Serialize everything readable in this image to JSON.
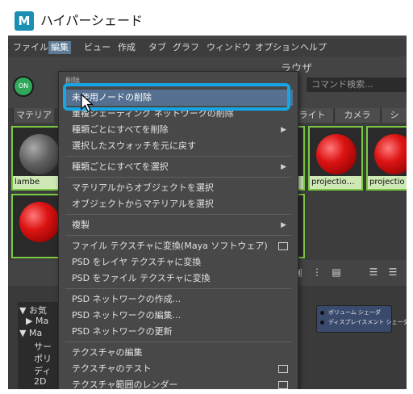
{
  "window": {
    "app_icon_letter": "M",
    "title": "ハイパーシェード"
  },
  "menubar": {
    "items": [
      "ファイル",
      "編集",
      "ビュー",
      "作成",
      "タブ",
      "グラフ",
      "ウィンドウ",
      "オプション",
      "ヘルプ"
    ],
    "active": "編集"
  },
  "toolbar": {
    "panel_title": "ラウザ",
    "search_placeholder": "コマンド検索..."
  },
  "tabs": [
    "マテリア",
    "ライト",
    "カメラ",
    "シ"
  ],
  "swatches": [
    {
      "label": "lambe"
    },
    {
      "label": "…"
    },
    {
      "label": "projectio…"
    },
    {
      "label": "projectio"
    }
  ],
  "tree": {
    "items": [
      "▼ お気",
      "▶ Ma",
      "▼ Ma",
      "サー",
      "ポリ",
      "ディ",
      "2D"
    ]
  },
  "node": {
    "lines": [
      "ボリューム シェーダ",
      "ディスプレイスメント シェーダ"
    ]
  },
  "dropdown": {
    "header": "削除",
    "items": [
      "未使用ノードの削除",
      "重複シェーディング ネットワークの削除",
      "種類ごとにすべてを削除",
      "選択したスウォッチを元に戻す",
      "種類ごとにすべてを選択",
      "マテリアルからオブジェクトを選択",
      "オブジェクトからマテリアルを選択",
      "複製",
      "ファイル テクスチャに変換(Maya ソフトウェア)",
      "PSD をレイヤ テクスチャに変換",
      "PSD をファイル テクスチャに変換",
      "PSD ネットワークの作成...",
      "PSD ネットワークの編集...",
      "PSD ネットワークの更新",
      "テクスチャの編集",
      "テクスチャのテスト",
      "テクスチャ範囲のレンダー"
    ]
  },
  "colors": {
    "accent_callout": "#16a6e6",
    "highlight": "#557090",
    "swatch_border": "#7ac943",
    "label_bg": "#cfe8b6",
    "on_toggle": "#2fa85a"
  },
  "icons": [
    "maya-app-icon",
    "on-toggle-icon",
    "submenu-arrow-icon",
    "option-box-icon",
    "mouse-cursor-icon",
    "layout-icon"
  ]
}
